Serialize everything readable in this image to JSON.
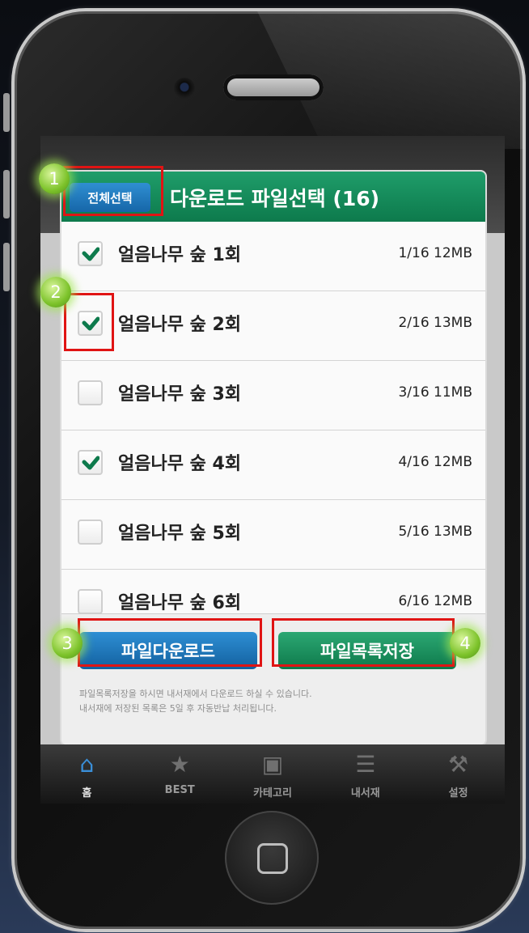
{
  "dialog": {
    "select_all_label": "전체선택",
    "title": "다운로드 파일선택 (16)",
    "header_color": "#0f8152"
  },
  "files": [
    {
      "name": "얼음나무 숲 1회",
      "meta": "1/16  12MB",
      "checked": true
    },
    {
      "name": "얼음나무 숲 2회",
      "meta": "2/16  13MB",
      "checked": true
    },
    {
      "name": "얼음나무 숲 3회",
      "meta": "3/16  11MB",
      "checked": false
    },
    {
      "name": "얼음나무 숲 4회",
      "meta": "4/16  12MB",
      "checked": true
    },
    {
      "name": "얼음나무 숲 5회",
      "meta": "5/16  13MB",
      "checked": false
    },
    {
      "name": "얼음나무 숲 6회",
      "meta": "6/16  12MB",
      "checked": false
    }
  ],
  "actions": {
    "download_label": "파일다운로드",
    "save_list_label": "파일목록저장",
    "notice_line1": "파일목록저장을 하시면 내서재에서 다운로드 하실 수 있습니다.",
    "notice_line2": "내서재에 저장된 목록은 5일 후 자동반납 처리됩니다."
  },
  "tabbar": {
    "items": [
      {
        "label": "홈",
        "icon": "home-icon",
        "active": true
      },
      {
        "label": "BEST",
        "icon": "star-icon",
        "active": false
      },
      {
        "label": "카테고리",
        "icon": "folder-icon",
        "active": false
      },
      {
        "label": "내서재",
        "icon": "bookshelf-icon",
        "active": false
      },
      {
        "label": "설정",
        "icon": "wrench-icon",
        "active": false
      }
    ]
  },
  "annotations": [
    "1",
    "2",
    "3",
    "4"
  ],
  "colors": {
    "check": "#0d7a4c",
    "callout": "#e01414",
    "badge": "#7dc32b"
  }
}
